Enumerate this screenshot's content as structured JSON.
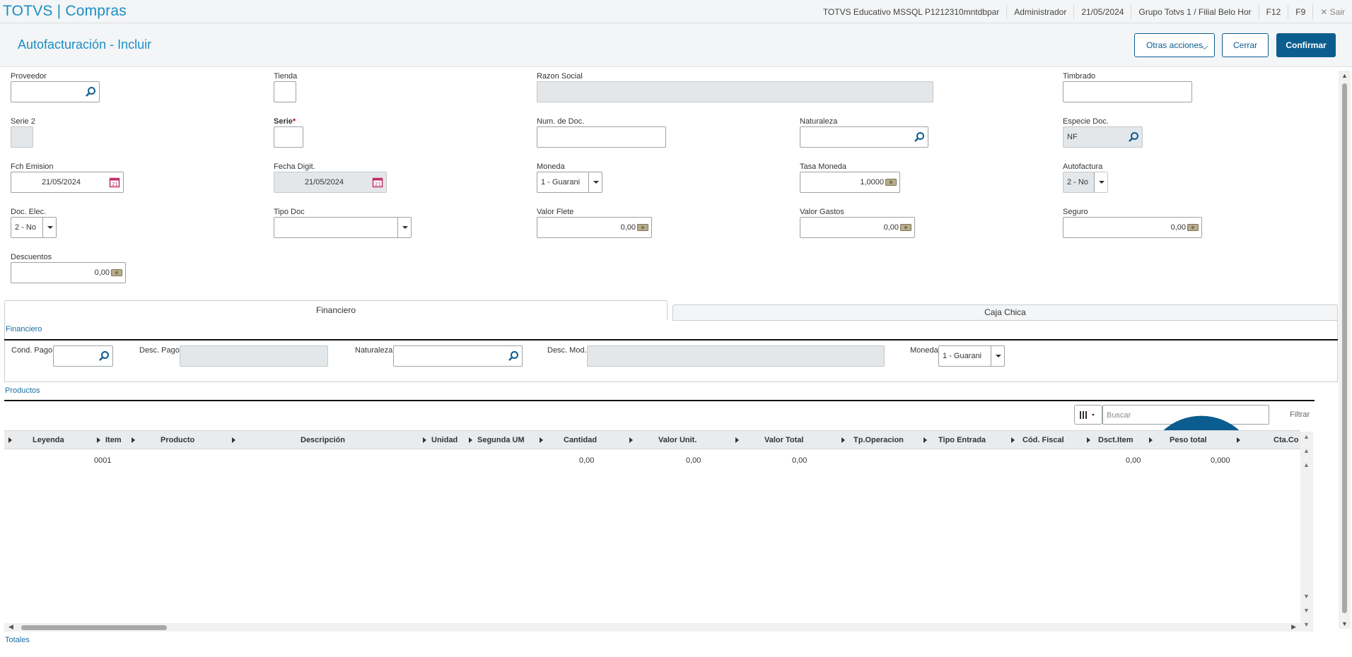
{
  "topbar": {
    "app_title": "TOTVS | Compras",
    "environment": "TOTVS Educativo MSSQL P1212310mntdbpar",
    "user": "Administrador",
    "date": "21/05/2024",
    "branch": "Grupo Totvs 1 / Filial Belo Hor",
    "f12": "F12",
    "f9": "F9",
    "exit": "Sair"
  },
  "header": {
    "title": "Autofacturación - Incluir",
    "other_actions": "Otras acciones",
    "close": "Cerrar",
    "confirm": "Confirmar"
  },
  "form": {
    "proveedor": {
      "label": "Proveedor",
      "value": ""
    },
    "tienda": {
      "label": "Tienda",
      "value": ""
    },
    "razon_social": {
      "label": "Razon Social",
      "value": ""
    },
    "timbrado": {
      "label": "Timbrado",
      "value": ""
    },
    "serie2": {
      "label": "Serie 2",
      "value": ""
    },
    "serie": {
      "label": "Serie",
      "required": "*",
      "value": ""
    },
    "num_doc": {
      "label": "Num. de Doc.",
      "value": ""
    },
    "naturaleza": {
      "label": "Naturaleza",
      "value": ""
    },
    "especie_doc": {
      "label": "Especie Doc.",
      "value": "NF"
    },
    "fch_emision": {
      "label": "Fch Emision",
      "value": "21/05/2024"
    },
    "fecha_digit": {
      "label": "Fecha Digit.",
      "value": "21/05/2024"
    },
    "moneda": {
      "label": "Moneda",
      "value": "1 - Guarani"
    },
    "tasa_moneda": {
      "label": "Tasa Moneda",
      "value": "1,0000"
    },
    "autofactura": {
      "label": "Autofactura",
      "value": "2 - No"
    },
    "doc_elec": {
      "label": "Doc. Elec.",
      "value": "2 - No"
    },
    "tipo_doc": {
      "label": "Tipo Doc",
      "value": ""
    },
    "valor_flete": {
      "label": "Valor Flete",
      "value": "0,00"
    },
    "valor_gastos": {
      "label": "Valor Gastos",
      "value": "0,00"
    },
    "seguro": {
      "label": "Seguro",
      "value": "0,00"
    },
    "descuentos": {
      "label": "Descuentos",
      "value": "0,00"
    }
  },
  "tabs": {
    "financiero": "Financiero",
    "caja_chica": "Caja Chica"
  },
  "financiero": {
    "section_title": "Financiero",
    "cond_pago": {
      "label": "Cond. Pago",
      "value": ""
    },
    "desc_pago": {
      "label": "Desc. Pago",
      "value": ""
    },
    "naturaleza": {
      "label": "Naturaleza",
      "value": ""
    },
    "desc_mod": {
      "label": "Desc. Mod.",
      "value": ""
    },
    "moneda": {
      "label": "Moneda",
      "value": "1 - Guarani"
    }
  },
  "productos": {
    "section_title": "Productos",
    "search_placeholder": "Buscar",
    "filter": "Filtrar",
    "columns": [
      "Leyenda",
      "Item",
      "Producto",
      "Descripción",
      "Unidad",
      "Segunda UM",
      "Cantidad",
      "Valor Unit.",
      "Valor Total",
      "Tp.Operacion",
      "Tipo Entrada",
      "Cód. Fiscal",
      "Dsct.Item",
      "Peso total",
      "Cta.Co"
    ],
    "rows": [
      {
        "item": "0001",
        "cantidad": "0,00",
        "valor_unit": "0,00",
        "valor_total": "0,00",
        "dsct_item": "0,00",
        "peso_total": "0,000"
      }
    ]
  },
  "totales": {
    "section_title": "Totales"
  },
  "colors": {
    "accent": "#1a8fc4",
    "primary_button": "#0c5d8f",
    "readonly_field": "#e4e7e9"
  }
}
